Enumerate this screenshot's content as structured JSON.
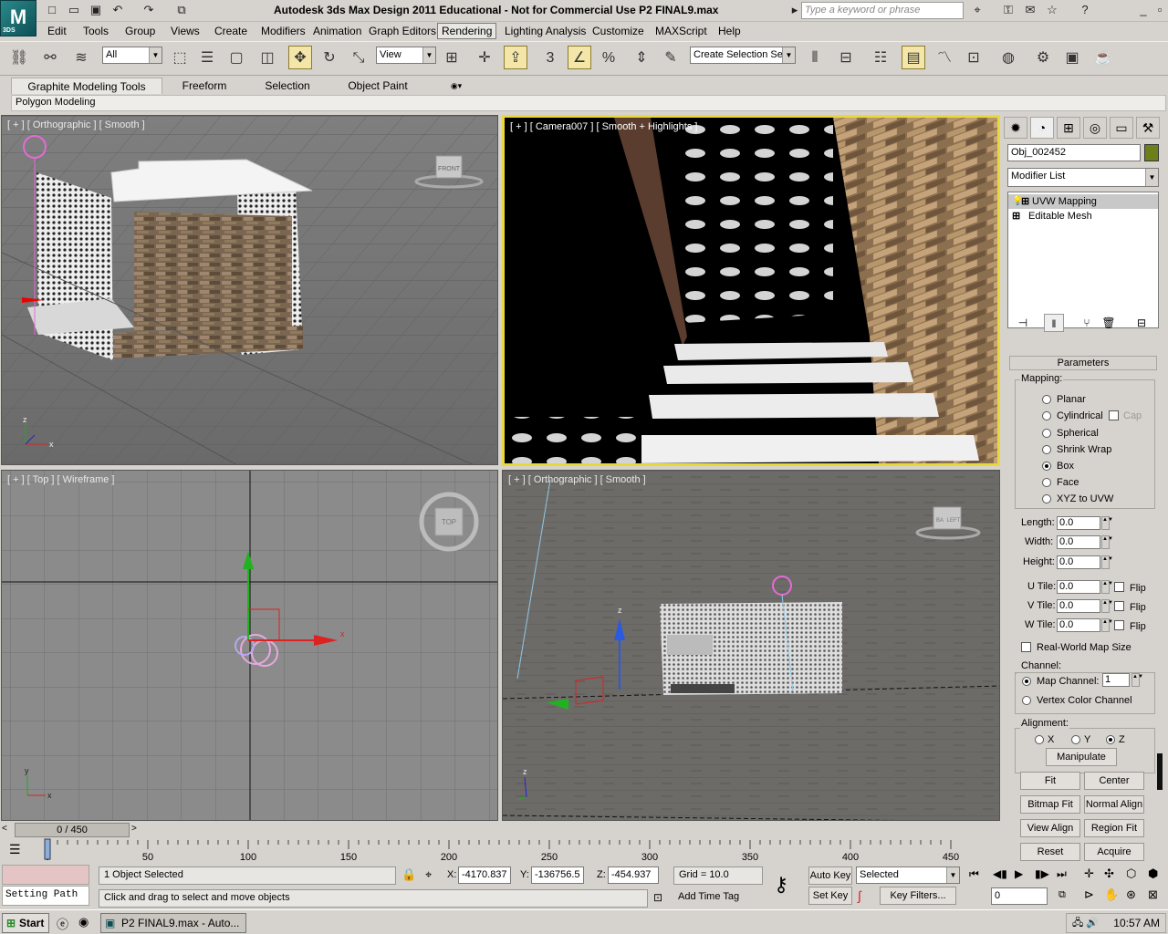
{
  "window": {
    "title": "Autodesk 3ds Max Design 2011   Educational - Not for Commercial Use   P2 FINAL9.max",
    "logo": "3DS",
    "search_placeholder": "Type a keyword or phrase"
  },
  "menus": [
    "Edit",
    "Tools",
    "Group",
    "Views",
    "Create",
    "Modifiers",
    "Animation",
    "Graph Editors",
    "Rendering",
    "Lighting Analysis",
    "Customize",
    "MAXScript",
    "Help"
  ],
  "toolbar": {
    "selection_filter": "All",
    "ref_coord": "View",
    "named_selection": "Create Selection Se",
    "snap_label": "3"
  },
  "ribbon": {
    "tabs": [
      "Graphite Modeling Tools",
      "Freeform",
      "Selection",
      "Object Paint"
    ],
    "active": "Graphite Modeling Tools",
    "sub_tab": "Polygon Modeling"
  },
  "viewports": {
    "perspective": {
      "label": "[ + ] [ Orthographic ] [ Smooth ]",
      "cube": "FRONT"
    },
    "camera": {
      "label": "[ + ] [ Camera007 ] [ Smooth + Highlights ]"
    },
    "top": {
      "label": "[ + ] [ Top ] [ Wireframe ]",
      "cube": "TOP"
    },
    "ortho": {
      "label": "[ + ] [ Orthographic ] [ Smooth ]",
      "cube": "LEFT",
      "cube_alt": "BA"
    },
    "axis_x": "x",
    "axis_y": "y",
    "axis_z": "z"
  },
  "command_panel": {
    "object_name": "Obj_002452",
    "modifier_list": "Modifier List",
    "stack": [
      "UVW Mapping",
      "Editable Mesh"
    ],
    "rollout": "Parameters",
    "mapping_label": "Mapping:",
    "mapping_options": [
      "Planar",
      "Cylindrical",
      "Spherical",
      "Shrink Wrap",
      "Box",
      "Face",
      "XYZ to UVW"
    ],
    "mapping_selected": "Box",
    "cap": "Cap",
    "length_label": "Length:",
    "length": "0.0",
    "width_label": "Width:",
    "width": "0.0",
    "height_label": "Height:",
    "height": "0.0",
    "utile_label": "U Tile:",
    "utile": "0.0",
    "vtile_label": "V Tile:",
    "vtile": "0.0",
    "wtile_label": "W Tile:",
    "wtile": "0.0",
    "flip": "Flip",
    "realworld": "Real-World Map Size",
    "channel_label": "Channel:",
    "map_channel_label": "Map Channel:",
    "map_channel": "1",
    "vertex_color": "Vertex Color Channel",
    "alignment_label": "Alignment:",
    "align_axes": [
      "X",
      "Y",
      "Z"
    ],
    "align_selected": "Z",
    "buttons": {
      "manipulate": "Manipulate",
      "fit": "Fit",
      "center": "Center",
      "bitmap_fit": "Bitmap Fit",
      "normal_align": "Normal Align",
      "view_align": "View Align",
      "region_fit": "Region Fit",
      "reset": "Reset",
      "acquire": "Acquire"
    }
  },
  "timeline": {
    "frame_display": "0 / 450",
    "ticks": [
      "0",
      "50",
      "100",
      "150",
      "200",
      "250",
      "300",
      "350",
      "400",
      "450"
    ],
    "current_frame": 0,
    "total_frames": 450
  },
  "status": {
    "maxscript_label": "Setting Path",
    "selected": "1 Object Selected",
    "prompt": "Click and drag to select and move objects",
    "x_label": "X:",
    "x": "-4170.837",
    "y_label": "Y:",
    "y": "-136756.5",
    "z_label": "Z:",
    "z": "-454.937",
    "grid": "Grid = 10.0",
    "add_time_tag": "Add Time Tag",
    "auto_key": "Auto Key",
    "set_key": "Set Key",
    "key_mode": "Selected",
    "key_filters": "Key Filters...",
    "frame_field": "0"
  },
  "taskbar": {
    "start": "Start",
    "task": "P2 FINAL9.max - Auto...",
    "clock": "10:57 AM"
  },
  "colors": {
    "active_viewport": "#e8d83a",
    "object_color": "#6b7f1a"
  }
}
